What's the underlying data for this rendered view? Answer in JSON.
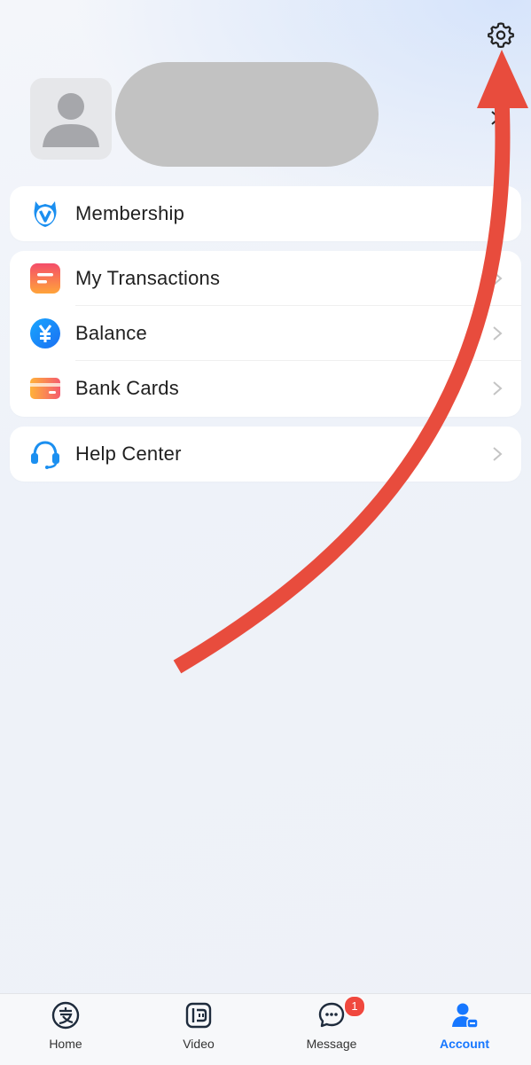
{
  "header": {
    "settings_icon": "gear-icon",
    "avatar_icon": "person-silhouette-icon"
  },
  "menu": {
    "membership": {
      "label": "Membership",
      "icon": "membership-shield-icon"
    },
    "transactions": {
      "label": "My Transactions",
      "icon": "transactions-icon"
    },
    "balance": {
      "label": "Balance",
      "icon": "yuan-coin-icon"
    },
    "bank_cards": {
      "label": "Bank Cards",
      "icon": "bank-card-icon"
    },
    "help_center": {
      "label": "Help Center",
      "icon": "headset-icon"
    }
  },
  "tabbar": {
    "home": {
      "label": "Home",
      "icon": "alipay-logo-icon"
    },
    "video": {
      "label": "Video",
      "icon": "video-icon"
    },
    "message": {
      "label": "Message",
      "icon": "chat-bubble-icon",
      "badge": "1"
    },
    "account": {
      "label": "Account",
      "icon": "account-person-icon",
      "active": true
    }
  },
  "annotation": {
    "type": "red-curved-arrow",
    "color": "#e84c3d",
    "points_to": "settings-button"
  },
  "colors": {
    "accent": "#1677ff",
    "badge": "#f0483e",
    "arrow": "#e84c3d"
  }
}
